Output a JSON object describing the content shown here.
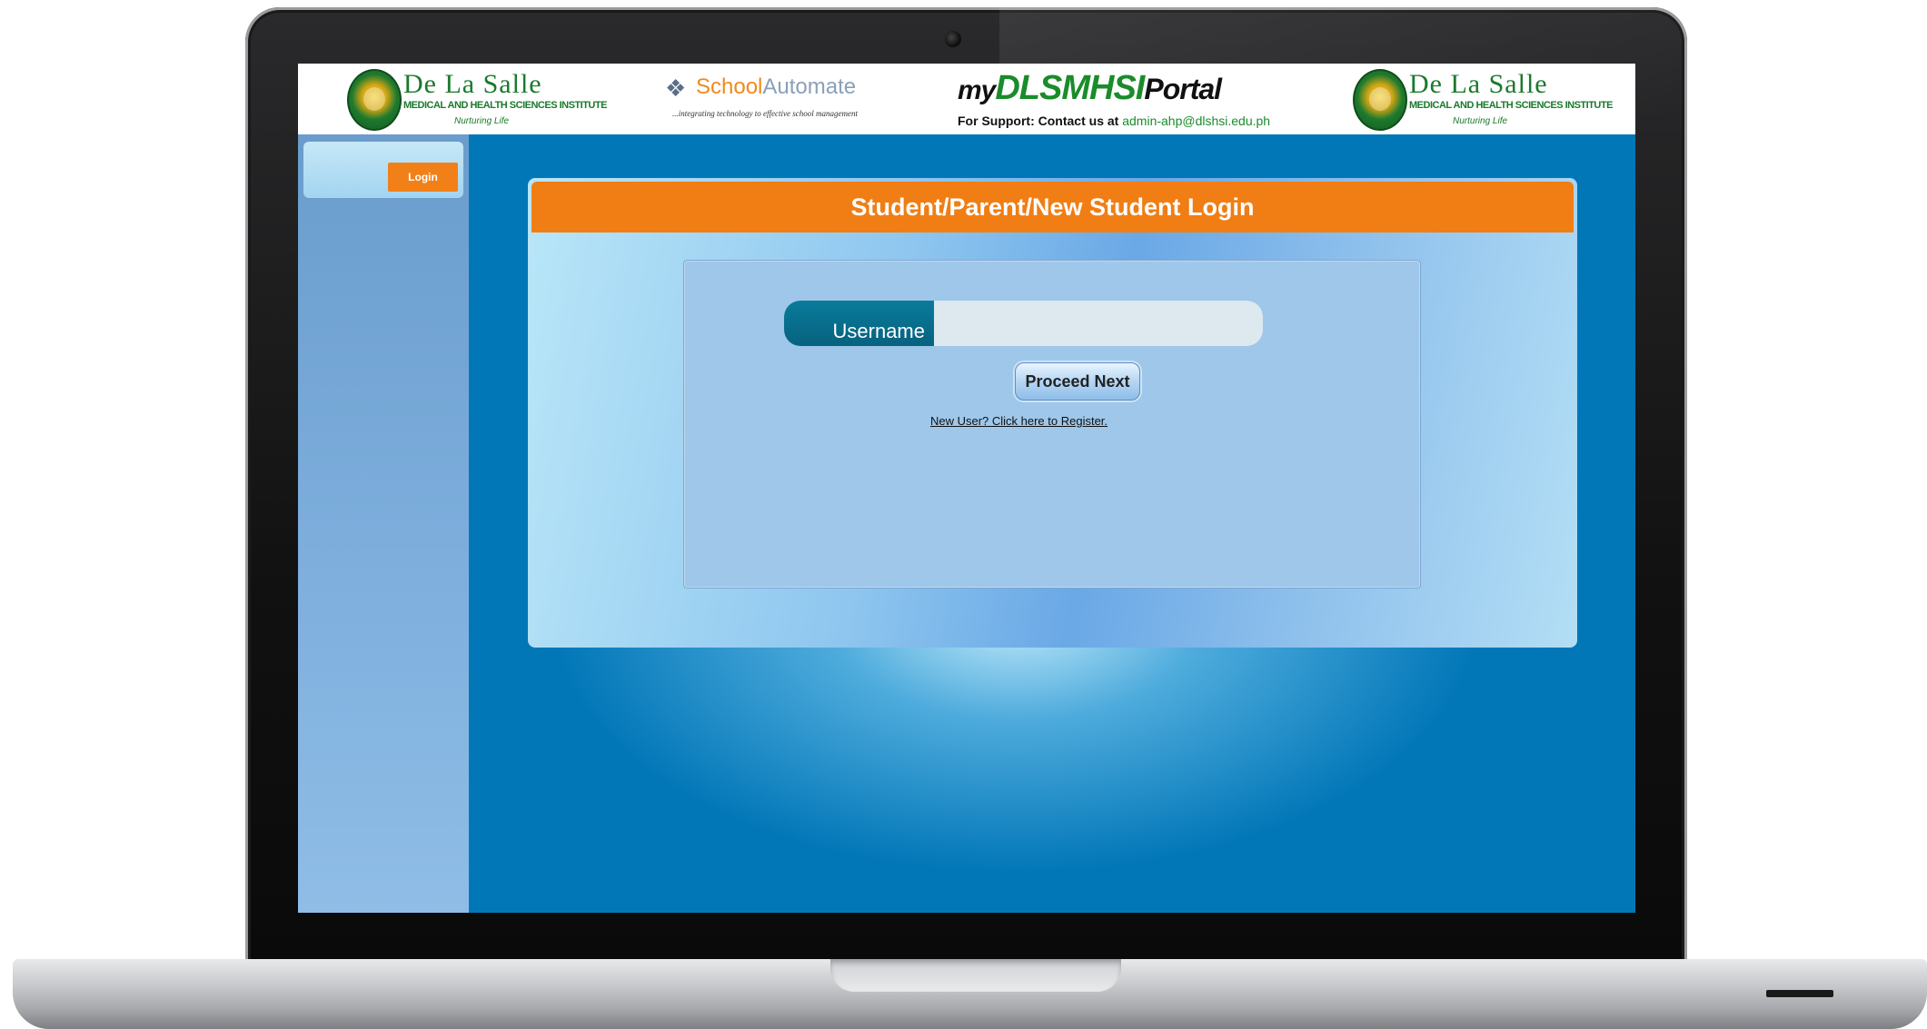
{
  "header": {
    "left_logo": {
      "name": "De La Salle",
      "subtitle": "MEDICAL AND HEALTH SCIENCES INSTITUTE",
      "tagline": "Nurturing Life"
    },
    "school_automate": {
      "part1": "School",
      "part2": "Automate",
      "tagline": "...integrating technology to effective school management"
    },
    "portal": {
      "prefix": "my",
      "name": "DLSMHSI",
      "suffix": "Portal",
      "support_label": "For Support: Contact us at",
      "support_email": "admin-ahp@dlshsi.edu.ph"
    },
    "right_logo": {
      "name": "De La Salle",
      "subtitle": "MEDICAL AND HEALTH SCIENCES INSTITUTE",
      "tagline": "Nurturing Life"
    }
  },
  "sidebar": {
    "login_label": "Login"
  },
  "login_panel": {
    "title": "Student/Parent/New Student Login",
    "username_label": "Username",
    "username_value": "",
    "proceed_label": "Proceed Next",
    "register_link": "New User? Click here to Register."
  },
  "colors": {
    "accent_orange": "#f07e14",
    "screen_blue": "#0277b8",
    "brand_green": "#1a7a2c"
  }
}
